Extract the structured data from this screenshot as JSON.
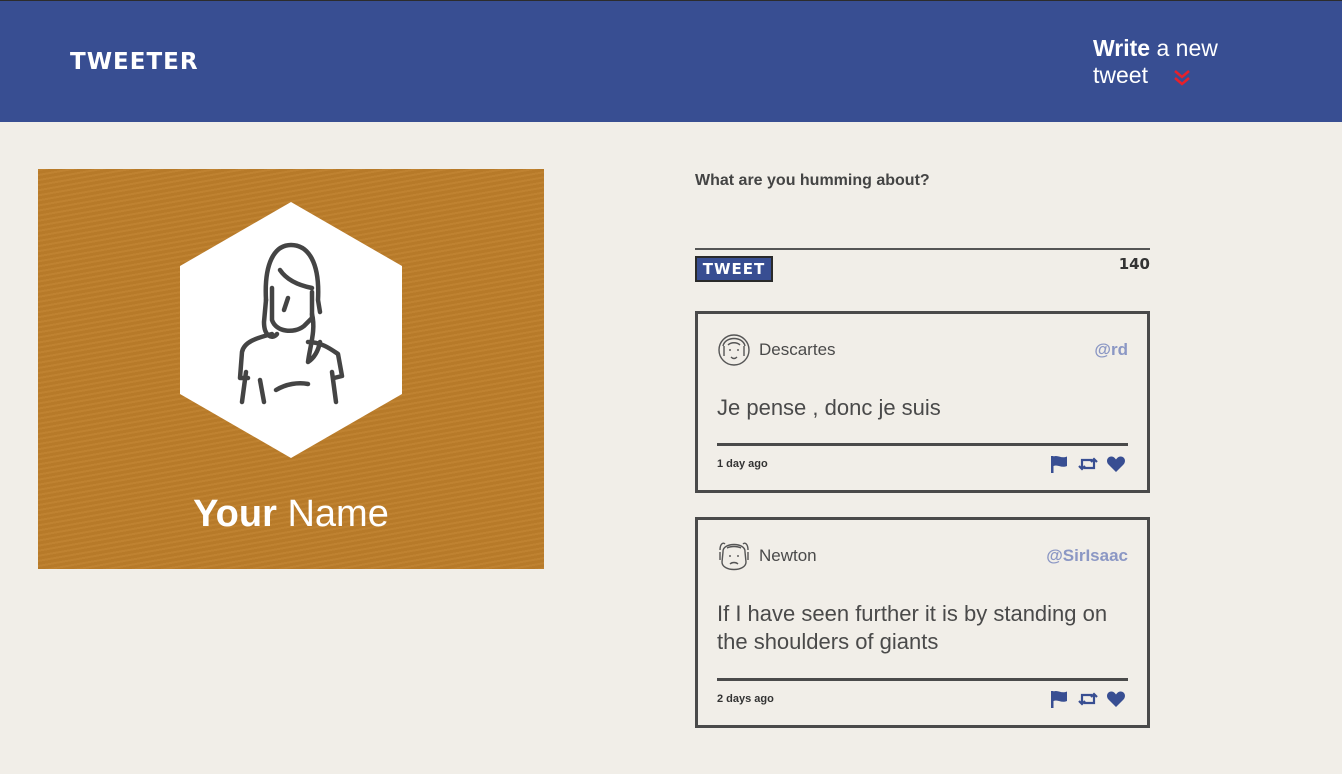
{
  "header": {
    "logo": "TWEETER",
    "compose_strong": "Write",
    "compose_light": " a new tweet"
  },
  "profile": {
    "name_strong": "Your",
    "name_light": " Name"
  },
  "composer": {
    "label": "What are you humming about?",
    "input_value": "",
    "button_label": "TWEET",
    "counter": "140"
  },
  "tweets": [
    {
      "author": "Descartes",
      "handle": "@rd",
      "text": "Je pense , donc je suis",
      "time": "1 day ago"
    },
    {
      "author": "Newton",
      "handle": "@SirIsaac",
      "text": "If I have seen further it is by standing on the shoulders of giants",
      "time": "2 days ago"
    }
  ],
  "colors": {
    "header_bg": "#384e92",
    "page_bg": "#f1eee8",
    "profile_bg": "#bd7e2a",
    "chevron": "#e8202a",
    "handle": "#8b97c4"
  },
  "icons": {
    "flag": "flag-icon",
    "retweet": "retweet-icon",
    "like": "heart-icon",
    "compose_toggle": "chevron-double-down-icon"
  }
}
